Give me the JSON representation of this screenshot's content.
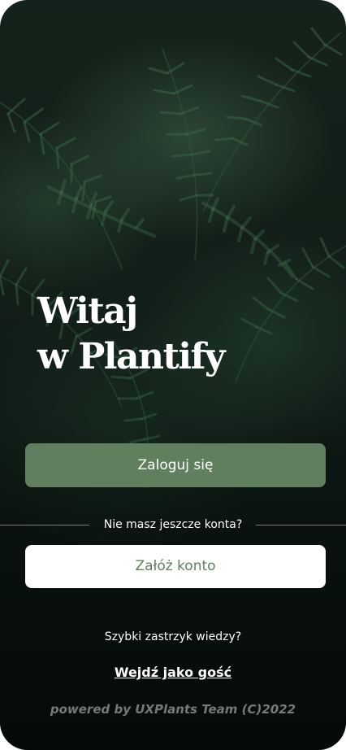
{
  "welcome": {
    "title_line1": "Witaj",
    "title_line2": "w Plantify"
  },
  "actions": {
    "login_label": "Zaloguj się",
    "no_account_text": "Nie masz jeszcze konta?",
    "register_label": "Załóż konto"
  },
  "guest": {
    "prompt": "Szybki zastrzyk wiedzy?",
    "link_label": "Wejdź jako gość"
  },
  "footer": {
    "powered_by": "powered by UXPlants Team (C)2022"
  },
  "colors": {
    "accent_green": "#5f7f5f",
    "background_dark": "#0f1b16",
    "text_light": "#ffffff"
  },
  "background_image": "fern-leaves-photo"
}
